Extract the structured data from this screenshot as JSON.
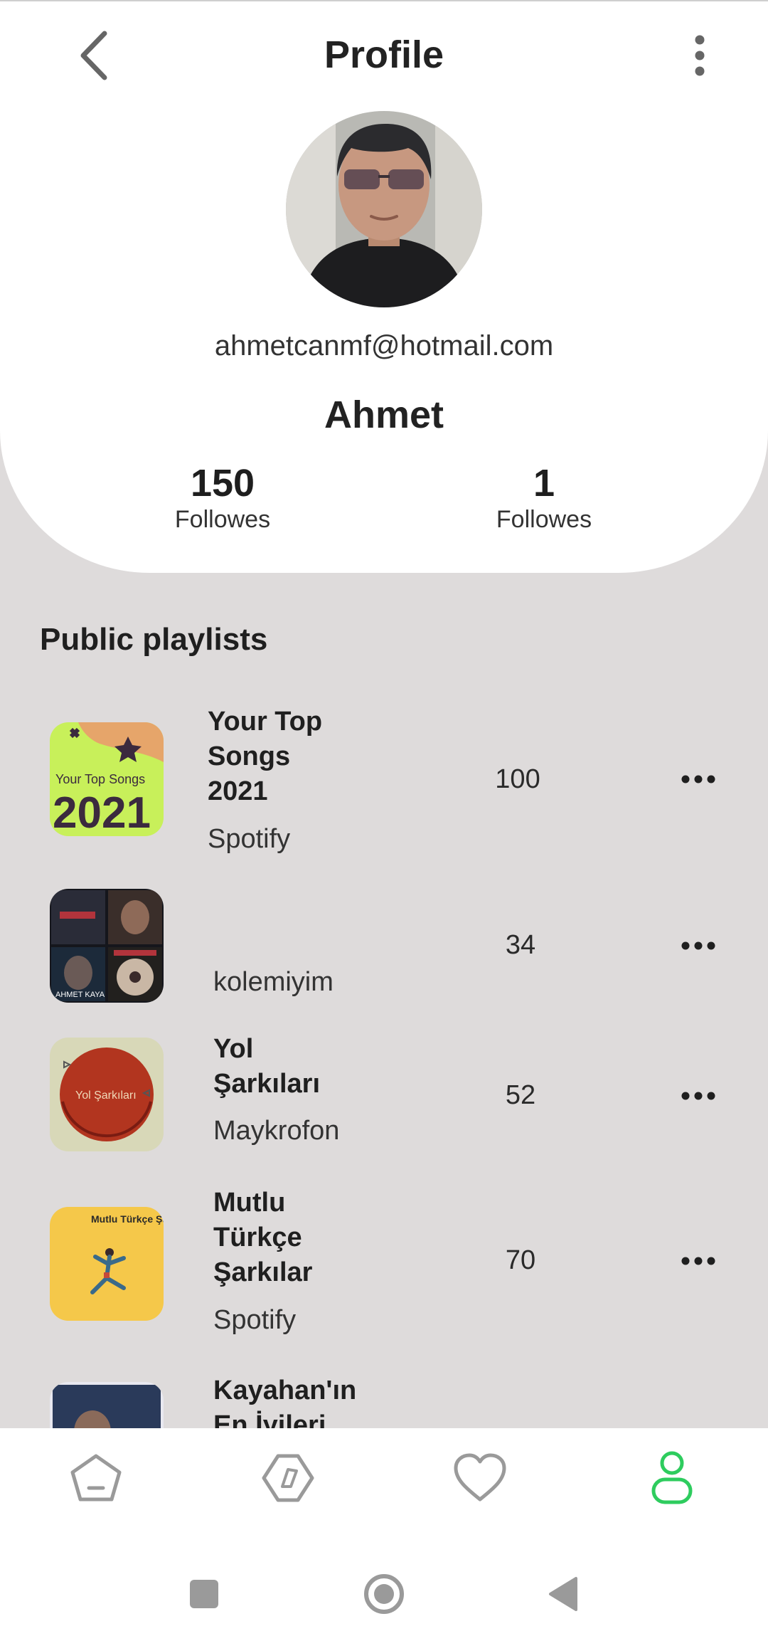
{
  "header": {
    "title": "Profile",
    "back_icon": "chevron-left-icon",
    "more_icon": "more-vertical-icon"
  },
  "profile": {
    "email": "ahmetcanmf@hotmail.com",
    "name": "Ahmet",
    "stats": [
      {
        "value": "150",
        "label": "Followes"
      },
      {
        "value": "1",
        "label": "Followes"
      }
    ]
  },
  "playlists": {
    "section_title": "Public playlists",
    "items": [
      {
        "title_lines": [
          "Your Top",
          "Songs",
          "2021"
        ],
        "owner": "Spotify",
        "count": "100",
        "cover_text_small": "Your Top Songs",
        "cover_text_big": "2021"
      },
      {
        "title_lines": [],
        "owner": "kolemiyim",
        "count": "34",
        "cover_text_small": "AHMET KAYA"
      },
      {
        "title_lines": [
          "Yol",
          "Şarkıları"
        ],
        "owner": "Maykrofon",
        "count": "52",
        "cover_text_small": "Yol Şarkıları"
      },
      {
        "title_lines": [
          "Mutlu",
          "Türkçe",
          "Şarkılar"
        ],
        "owner": "Spotify",
        "count": "70",
        "cover_text_small": "Mutlu Türkçe Şarkılar"
      },
      {
        "title_lines": [
          "Kayahan'ın",
          "En İyileri"
        ],
        "owner": "",
        "count": ""
      }
    ]
  },
  "bottom_nav": {
    "items": [
      {
        "icon": "home-icon",
        "active": false
      },
      {
        "icon": "explore-icon",
        "active": false
      },
      {
        "icon": "heart-icon",
        "active": false
      },
      {
        "icon": "profile-icon",
        "active": true
      }
    ],
    "active_color": "#2ecc5e",
    "inactive_color": "#9a9a9a"
  },
  "system_nav": {
    "buttons": [
      "recents-icon",
      "home-circle-icon",
      "back-triangle-icon"
    ]
  }
}
